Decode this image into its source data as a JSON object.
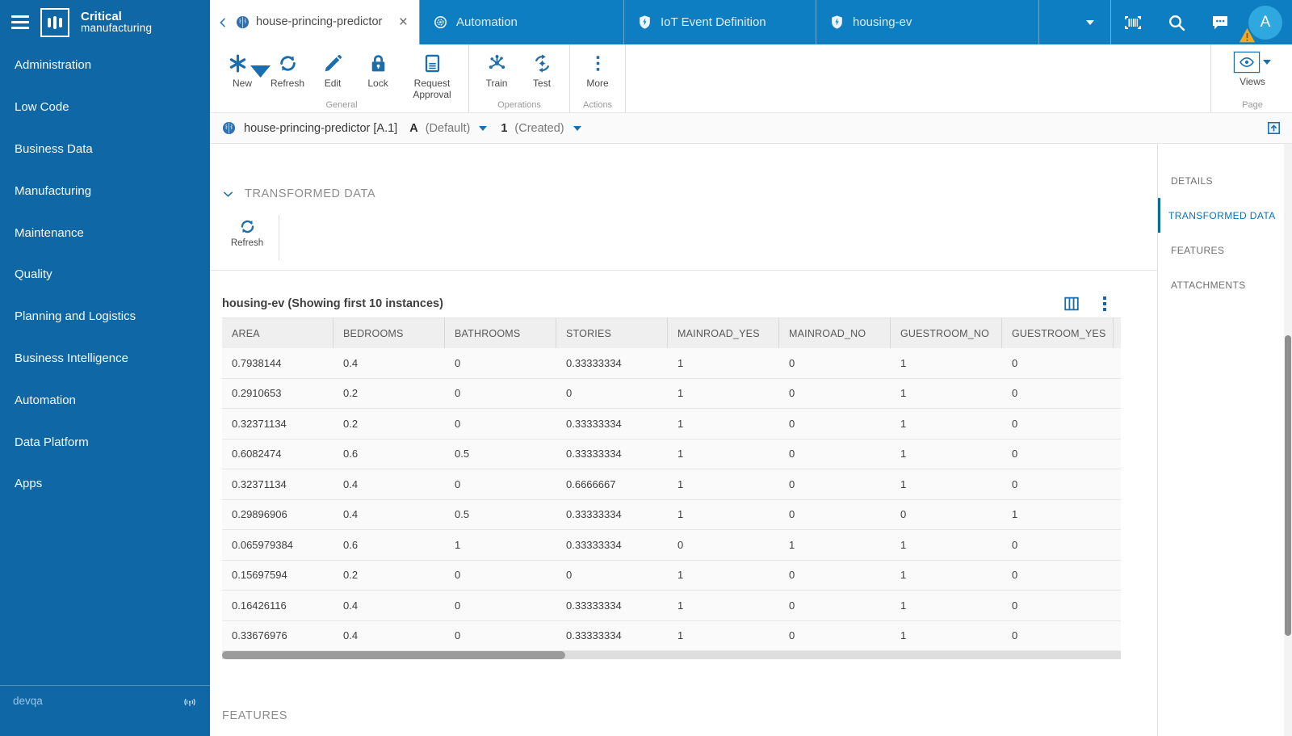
{
  "brand": {
    "line1": "Critical",
    "line2": "manufacturing"
  },
  "sidebar": {
    "items": [
      {
        "label": "Administration"
      },
      {
        "label": "Low Code"
      },
      {
        "label": "Business Data"
      },
      {
        "label": "Manufacturing"
      },
      {
        "label": "Maintenance"
      },
      {
        "label": "Quality"
      },
      {
        "label": "Planning and Logistics"
      },
      {
        "label": "Business Intelligence"
      },
      {
        "label": "Automation"
      },
      {
        "label": "Data Platform"
      },
      {
        "label": "Apps"
      }
    ],
    "footer": {
      "environment": "devqa"
    }
  },
  "tabbar": {
    "active_tab": {
      "label": "house-princing-predictor",
      "icon": "brain"
    },
    "tabs": [
      {
        "label": "Automation",
        "icon": "automation"
      },
      {
        "label": "IoT Event Definition",
        "icon": "shield"
      },
      {
        "label": "housing-ev",
        "icon": "shield"
      }
    ],
    "avatar_initial": "A"
  },
  "toolbar": {
    "groups": [
      {
        "label": "General",
        "buttons": [
          {
            "label": "New",
            "icon": "new",
            "has_dropdown": true
          },
          {
            "label": "Refresh",
            "icon": "refresh"
          },
          {
            "label": "Edit",
            "icon": "edit"
          },
          {
            "label": "Lock",
            "icon": "lock"
          },
          {
            "label": "Request Approval",
            "icon": "request-approval"
          }
        ]
      },
      {
        "label": "Operations",
        "buttons": [
          {
            "label": "Train",
            "icon": "train"
          },
          {
            "label": "Test",
            "icon": "test"
          }
        ]
      },
      {
        "label": "Actions",
        "buttons": [
          {
            "label": "More",
            "icon": "more"
          }
        ]
      }
    ],
    "page_group": {
      "label": "Page",
      "views_label": "Views"
    }
  },
  "breadcrumb": {
    "entity": "house-princing-predictor [A.1]",
    "version_letter": "A",
    "version_label": "(Default)",
    "revision_number": "1",
    "revision_label": "(Created)"
  },
  "panel": {
    "section_title": "TRANSFORMED DATA",
    "refresh_label": "Refresh",
    "table_title": "housing-ev (Showing first 10 instances)",
    "features_title": "FEATURES"
  },
  "right_nav": {
    "items": [
      {
        "label": "DETAILS",
        "active": false
      },
      {
        "label": "TRANSFORMED DATA",
        "active": true
      },
      {
        "label": "FEATURES",
        "active": false
      },
      {
        "label": "ATTACHMENTS",
        "active": false
      }
    ]
  },
  "table": {
    "columns": [
      "AREA",
      "BEDROOMS",
      "BATHROOMS",
      "STORIES",
      "MAINROAD_YES",
      "MAINROAD_NO",
      "GUESTROOM_NO",
      "GUESTROOM_YES"
    ],
    "rows": [
      [
        "0.7938144",
        "0.4",
        "0",
        "0.33333334",
        "1",
        "0",
        "1",
        "0"
      ],
      [
        "0.2910653",
        "0.2",
        "0",
        "0",
        "1",
        "0",
        "1",
        "0"
      ],
      [
        "0.32371134",
        "0.2",
        "0",
        "0.33333334",
        "1",
        "0",
        "1",
        "0"
      ],
      [
        "0.6082474",
        "0.6",
        "0.5",
        "0.33333334",
        "1",
        "0",
        "1",
        "0"
      ],
      [
        "0.32371134",
        "0.4",
        "0",
        "0.6666667",
        "1",
        "0",
        "1",
        "0"
      ],
      [
        "0.29896906",
        "0.4",
        "0.5",
        "0.33333334",
        "1",
        "0",
        "0",
        "1"
      ],
      [
        "0.065979384",
        "0.6",
        "1",
        "0.33333334",
        "0",
        "1",
        "1",
        "0"
      ],
      [
        "0.15697594",
        "0.2",
        "0",
        "0",
        "1",
        "0",
        "1",
        "0"
      ],
      [
        "0.16426116",
        "0.4",
        "0",
        "0.33333334",
        "1",
        "0",
        "1",
        "0"
      ],
      [
        "0.33676976",
        "0.4",
        "0",
        "0.33333334",
        "1",
        "0",
        "1",
        "0"
      ]
    ]
  },
  "colors": {
    "sidebar_bg": "#0F67A6",
    "topbar_bg": "#0E7EC2",
    "accent": "#1B6EAE",
    "nav_active_text": "#0C71B8",
    "avatar_bg": "#2FA8E0",
    "warning": "#F5A623"
  }
}
